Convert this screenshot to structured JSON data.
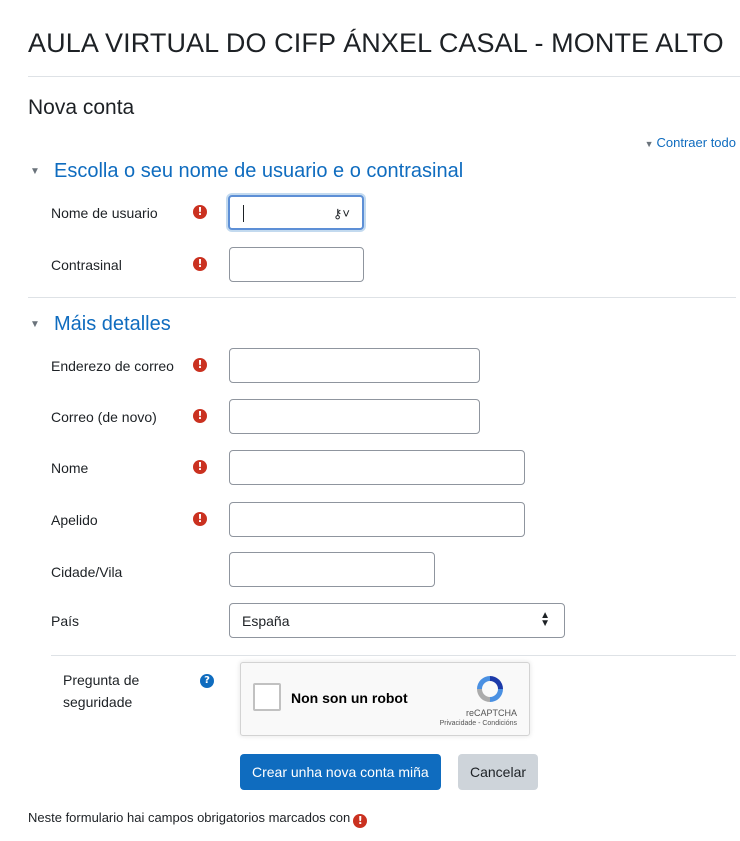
{
  "site_title": "AULA VIRTUAL DO CIFP ÁNXEL CASAL - MONTE ALTO",
  "page_heading": "Nova conta",
  "collapse_all_label": "Contraer todo",
  "required_marker": "!",
  "sections": [
    {
      "title": "Escolla o seu nome de usuario e o contrasinal"
    },
    {
      "title": "Máis detalles"
    }
  ],
  "fields": {
    "username": {
      "label": "Nome de usuario",
      "value": ""
    },
    "password": {
      "label": "Contrasinal",
      "value": ""
    },
    "email": {
      "label": "Enderezo de correo",
      "value": ""
    },
    "email_again": {
      "label": "Correo (de novo)",
      "value": ""
    },
    "firstname": {
      "label": "Nome",
      "value": ""
    },
    "lastname": {
      "label": "Apelido",
      "value": ""
    },
    "city": {
      "label": "Cidade/Vila",
      "value": ""
    },
    "country": {
      "label": "País",
      "selected": "España"
    }
  },
  "security_question": {
    "label_line1": "Pregunta de",
    "label_line2": "seguridade"
  },
  "recaptcha": {
    "checkbox_label": "Non son un robot",
    "brand": "reCAPTCHA",
    "links": "Privacidade - Condicións"
  },
  "buttons": {
    "submit": "Crear unha nova conta miña",
    "cancel": "Cancelar"
  },
  "footnote": "Neste formulario hai campos obrigatorios marcados con",
  "colors": {
    "link": "#0f6cbf",
    "required": "#ca3120",
    "primary_button": "#0f6cbf",
    "secondary_button": "#ced4da"
  }
}
